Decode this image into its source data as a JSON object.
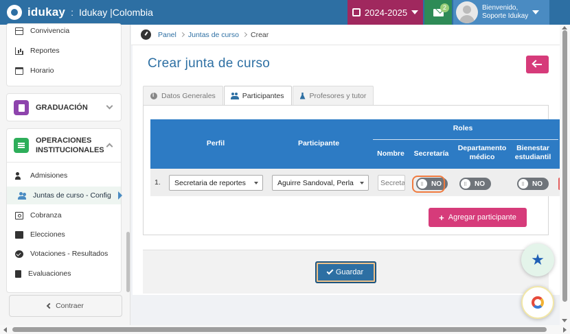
{
  "header": {
    "brand": "idukay",
    "separator": ":",
    "school": "Idukay |Colombia",
    "year": "2024-2025",
    "messages_count": "2",
    "greeting": "Bienvenido,",
    "user_name": "Soporte Idukay"
  },
  "sidebar": {
    "top_items": [
      {
        "label": "Convivencia",
        "icon": "table-icon"
      },
      {
        "label": "Reportes",
        "icon": "bar-chart-icon"
      },
      {
        "label": "Horario",
        "icon": "calendar-icon"
      }
    ],
    "sections": [
      {
        "label": "GRADUACIÓN",
        "color": "#8e44ad",
        "icon": "document-icon"
      },
      {
        "label_line1": "OPERACIONES",
        "label_line2": "INSTITUCIONALES",
        "color": "#2eae5a",
        "icon": "list-icon"
      }
    ],
    "sub_items": [
      {
        "label": "Admisiones",
        "icon": "user-plus-icon"
      },
      {
        "label": "Juntas de curso - Config",
        "icon": "users-icon",
        "active": true
      },
      {
        "label": "Cobranza",
        "icon": "money-icon"
      },
      {
        "label": "Elecciones",
        "icon": "archive-icon"
      },
      {
        "label": "Votaciones - Resultados",
        "icon": "check-circle-icon"
      },
      {
        "label": "Evaluaciones",
        "icon": "clipboard-icon"
      }
    ],
    "collapse_label": "Contraer"
  },
  "breadcrumb": {
    "items": [
      "Panel",
      "Juntas de curso",
      "Crear"
    ]
  },
  "page": {
    "title": "Crear junta de curso",
    "tabs": [
      {
        "label": "Datos Generales",
        "icon": "info-icon"
      },
      {
        "label": "Participantes",
        "icon": "users-icon",
        "active": true
      },
      {
        "label": "Profesores y tutor",
        "icon": "flask-icon"
      }
    ]
  },
  "participants_table": {
    "headers": {
      "perfil": "Perfil",
      "participante": "Participante",
      "roles": "Roles",
      "nombre": "Nombre",
      "secretaria": "Secretaría",
      "departamento_line1": "Departamento",
      "departamento_line2": "médico",
      "bienestar_line1": "Bienestar",
      "bienestar_line2": "estudiantil"
    },
    "rows": [
      {
        "number": "1.",
        "perfil": "Secretaria de reportes",
        "participante": "Aguirre Sandoval, Perla",
        "nombre_placeholder": "Secretaria",
        "secretaria": "NO",
        "departamento": "NO",
        "bienestar": "NO"
      }
    ]
  },
  "actions": {
    "add_participant": "Agregar participante",
    "save": "Guardar"
  },
  "colors": {
    "primary": "#2d6fa3",
    "header_table": "#2d7bc4",
    "accent_pink": "#d63b7a",
    "year_bg": "#a0285e",
    "messages_bg": "#2e8b57",
    "focus_ring": "#f07a3e"
  }
}
